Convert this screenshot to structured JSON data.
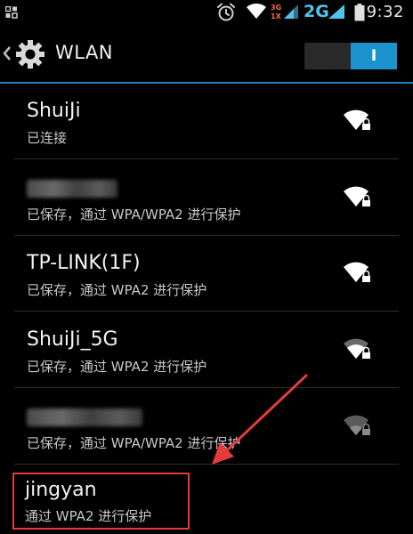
{
  "status_bar": {
    "time": "9:32",
    "network_type": "2G",
    "data_badge_top": "3G",
    "data_badge_bottom": "1X",
    "icons": [
      "gallery-icon",
      "alarm-icon",
      "wifi-icon",
      "signal-icon",
      "battery-icon"
    ]
  },
  "action_bar": {
    "title": "WLAN",
    "toggle_label": "I",
    "toggle_state": "on",
    "accent_color": "#1c93cc"
  },
  "networks": [
    {
      "name": "ShuiJi",
      "status": "已连接",
      "blurred": false,
      "signal": "strong"
    },
    {
      "name": "",
      "status": "已保存，通过 WPA/WPA2 进行保护",
      "blurred": true,
      "signal": "strong"
    },
    {
      "name": "TP-LINK(1F)",
      "status": "已保存，通过 WPA2 进行保护",
      "blurred": false,
      "signal": "strong"
    },
    {
      "name": "ShuiJi_5G",
      "status": "已保存，通过 WPA2 进行保护",
      "blurred": false,
      "signal": "medium"
    },
    {
      "name": "",
      "status": "已保存，通过 WPA/WPA2 进行保护",
      "blurred": true,
      "signal": "weak"
    },
    {
      "name": "jingyan",
      "status": "通过 WPA2 进行保护",
      "blurred": false,
      "signal": "none",
      "highlighted": true
    }
  ],
  "annotation": {
    "color": "#e63b3b",
    "target": "jingyan"
  }
}
